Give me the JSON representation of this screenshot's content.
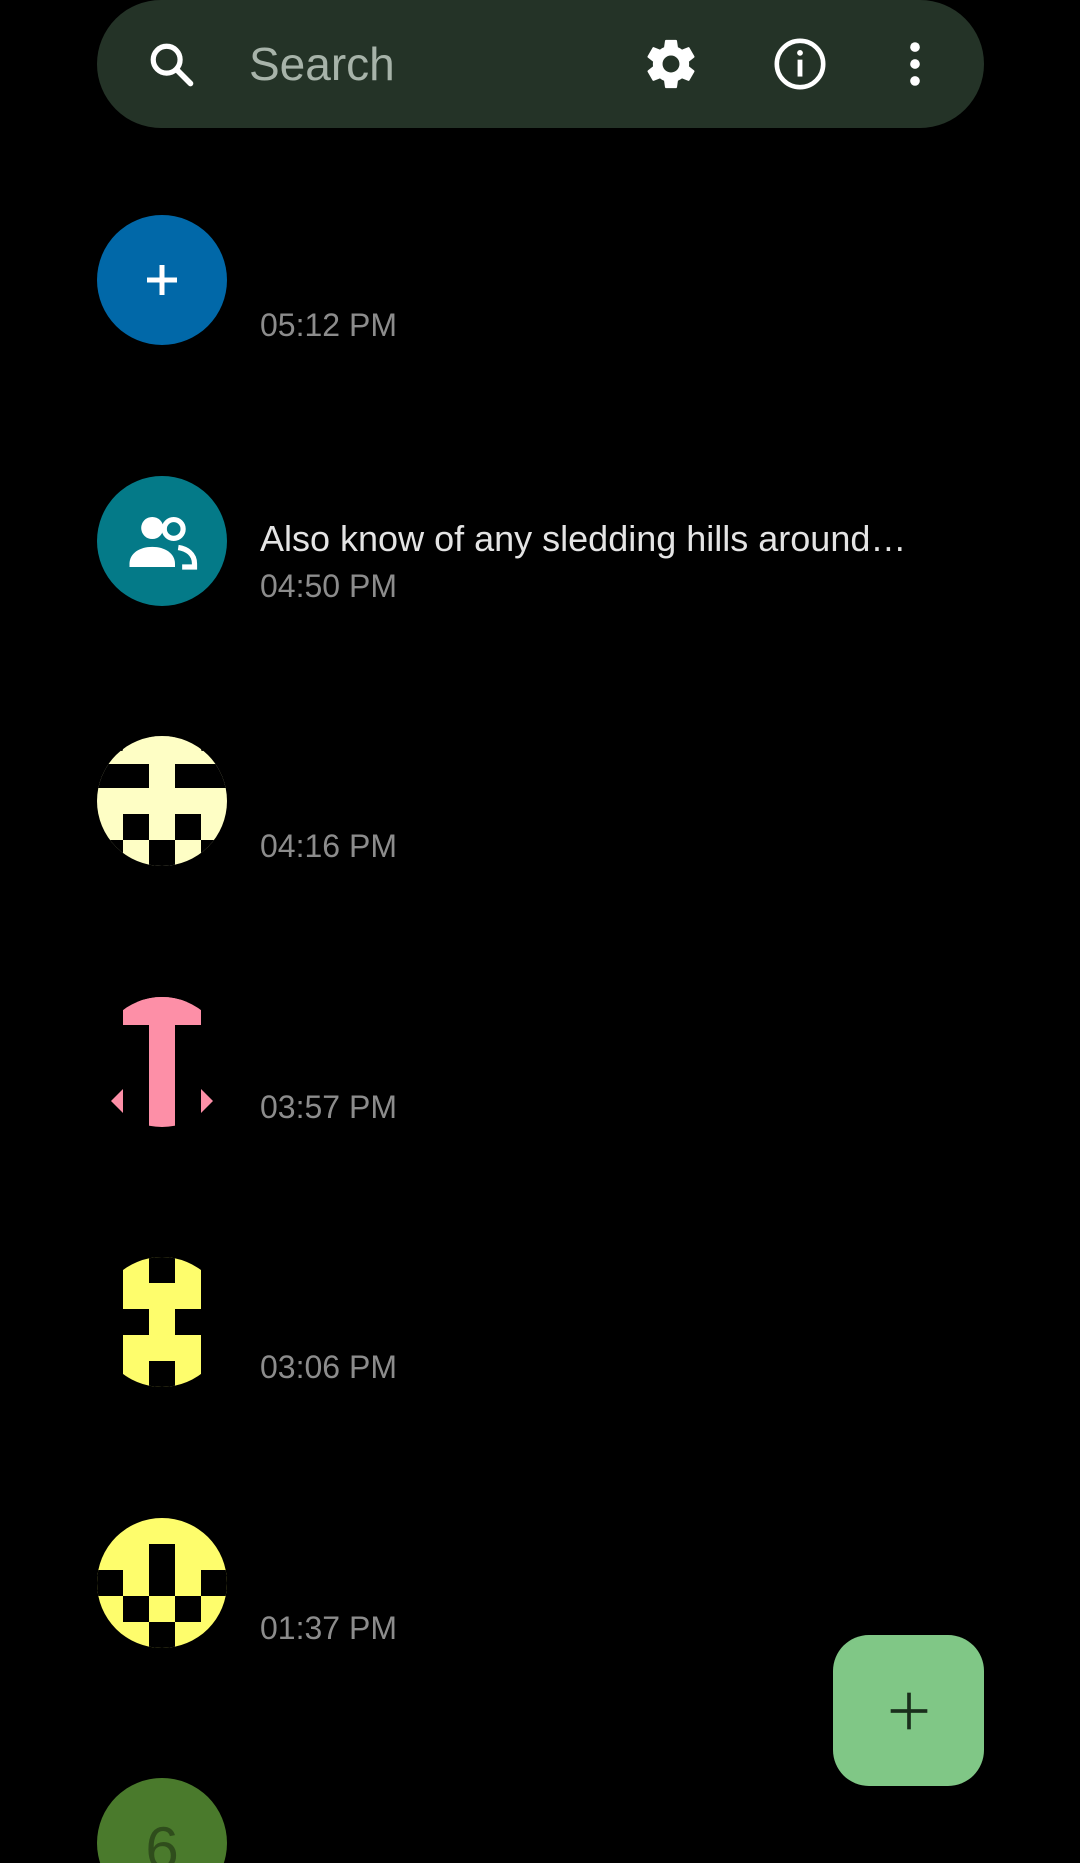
{
  "search": {
    "placeholder": "Search",
    "icons": [
      "search-icon",
      "gear-icon",
      "info-icon",
      "more-vert-icon"
    ],
    "background": "#243327"
  },
  "conversations": [
    {
      "avatar": "add-person-icon",
      "avatar_color": "#0168a8",
      "snippet": "",
      "time": "05:12 PM"
    },
    {
      "avatar": "group-icon",
      "avatar_color": "#047a88",
      "snippet": "Also know of any sledding hills around…",
      "time": "04:50 PM"
    },
    {
      "avatar": "identicon",
      "avatar_color": "#fefec5",
      "snippet": "",
      "time": "04:16 PM"
    },
    {
      "avatar": "identicon",
      "avatar_color": "#fd8fa7",
      "snippet": "",
      "time": "03:57 PM"
    },
    {
      "avatar": "identicon",
      "avatar_color": "#fefd6c",
      "snippet": "",
      "time": "03:06 PM"
    },
    {
      "avatar": "identicon",
      "avatar_color": "#fefd6c",
      "snippet": "",
      "time": "01:37 PM"
    },
    {
      "avatar": "letter-avatar",
      "avatar_color": "#4a7a2c",
      "letter": "6"
    }
  ],
  "fab": {
    "icon": "plus-icon",
    "color": "#80c786"
  }
}
